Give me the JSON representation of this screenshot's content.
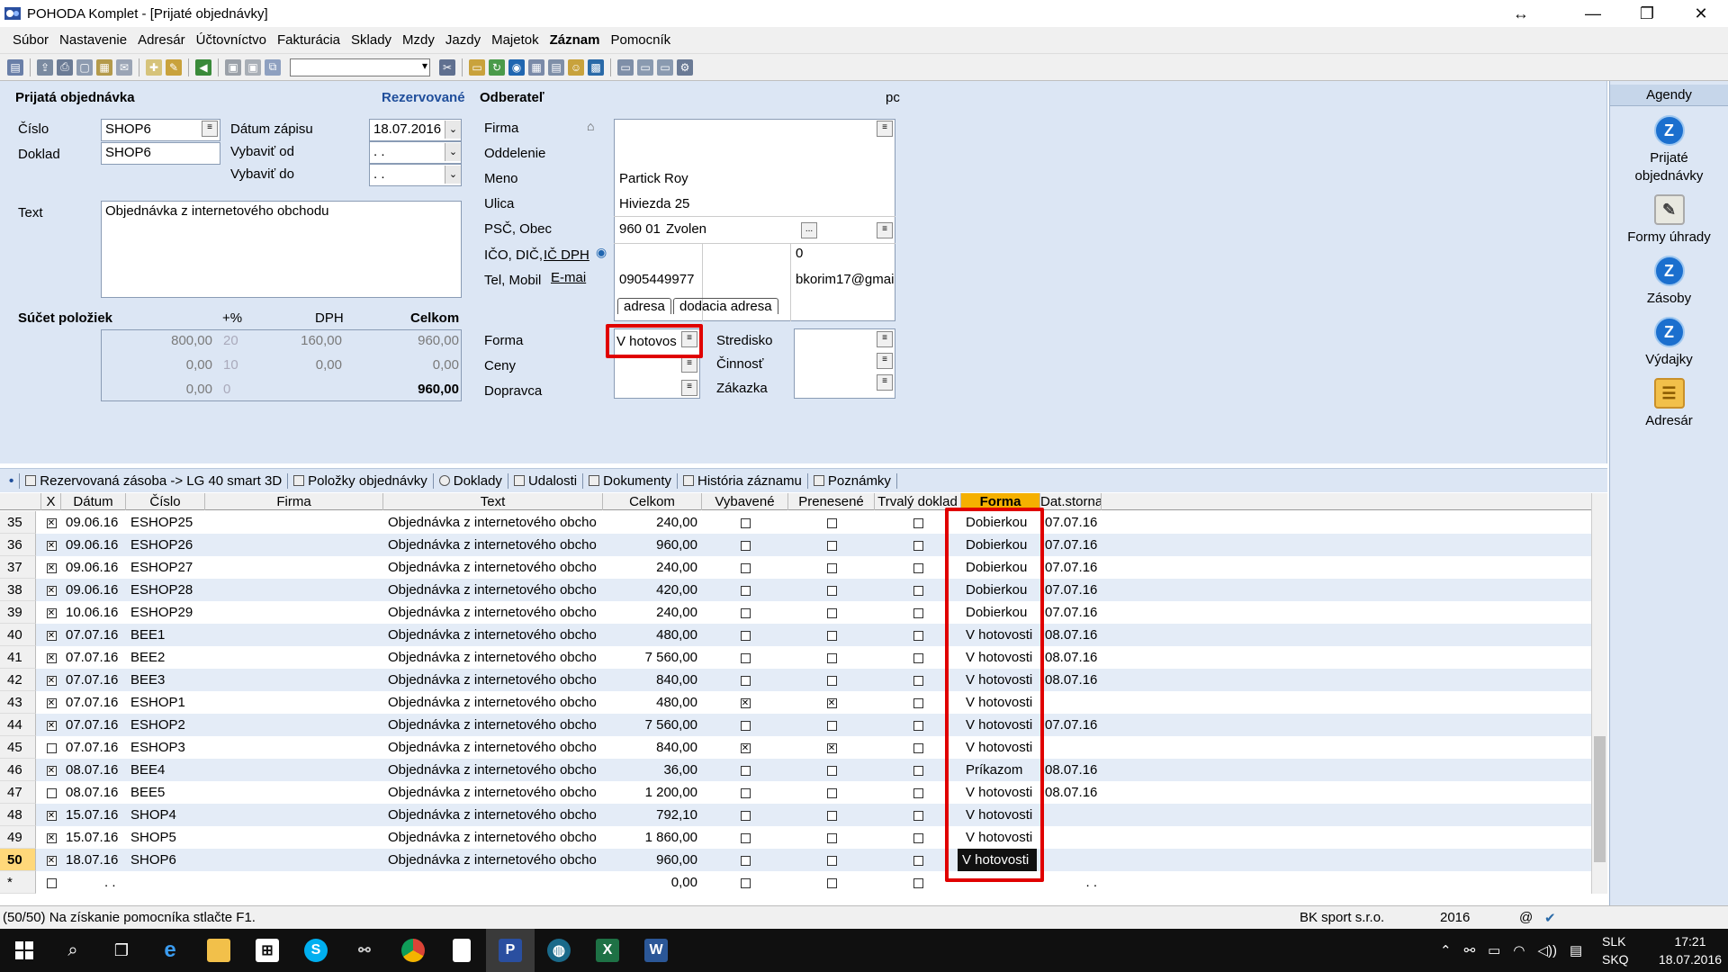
{
  "window": {
    "title": "POHODA Komplet - [Prijaté objednávky]"
  },
  "menu": [
    "Súbor",
    "Nastavenie",
    "Adresár",
    "Účtovníctvo",
    "Fakturácia",
    "Sklady",
    "Mzdy",
    "Jazdy",
    "Majetok",
    "Záznam",
    "Pomocník"
  ],
  "form": {
    "section_title": "Prijatá objednávka",
    "status": "Rezervované",
    "cislo_label": "Číslo",
    "cislo_value": "SHOP6",
    "doklad_label": "Doklad",
    "doklad_value": "SHOP6",
    "datum_zapisu_label": "Dátum zápisu",
    "datum_zapisu_value": "18.07.2016",
    "vybavit_od_label": "Vybaviť od",
    "vybavit_od_value": ". .",
    "vybavit_do_label": "Vybaviť do",
    "vybavit_do_value": ". .",
    "text_label": "Text",
    "text_value": "Objednávka z internetového obchodu",
    "sucet_label": "Súčet položiek",
    "col_pct": "+%",
    "col_dph": "DPH",
    "col_celkom": "Celkom",
    "sum_rows": [
      {
        "base": "800,00",
        "pct": "20",
        "dph": "160,00",
        "total": "960,00"
      },
      {
        "base": "0,00",
        "pct": "10",
        "dph": "0,00",
        "total": "0,00"
      },
      {
        "base": "0,00",
        "pct": "0",
        "dph": "",
        "total": "960,00"
      }
    ],
    "odberatel_label": "Odberateľ",
    "pc": "pc",
    "firma_label": "Firma",
    "oddelenie_label": "Oddelenie",
    "meno_label": "Meno",
    "meno_value": "Partick Roy",
    "ulica_label": "Ulica",
    "ulica_value": "Hiviezda 25",
    "psc_label": "PSČ, Obec",
    "psc_value": "960 01",
    "obec_value": "Zvolen",
    "ico_label": "IČO, DIČ,",
    "ic_dph_label": "IČ DPH",
    "ic_dph_value": "0",
    "tel_label": "Tel, Mobil",
    "email_label": "E-mai",
    "tel_value": "0905449977",
    "email_value": "bkorim17@gmai",
    "addr_tab1": "adresa",
    "addr_tab2": "dodacia adresa",
    "forma_label": "Forma",
    "forma_value": "V hotovos",
    "ceny_label": "Ceny",
    "dopravca_label": "Dopravca",
    "stredisko_label": "Stredisko",
    "cinnost_label": "Činnosť",
    "zakazka_label": "Zákazka"
  },
  "sidebar": {
    "title": "Agendy",
    "items": [
      {
        "label": "Prijaté objednávky",
        "icon": "order-icon"
      },
      {
        "label": "Formy úhrady",
        "icon": "payment-form-icon"
      },
      {
        "label": "Zásoby",
        "icon": "stock-icon"
      },
      {
        "label": "Výdajky",
        "icon": "issue-icon"
      },
      {
        "label": "Adresár",
        "icon": "address-book-icon"
      }
    ]
  },
  "tabs": [
    "Rezervovaná zásoba -> LG 40 smart 3D",
    "Položky objednávky",
    "Doklady",
    "Udalosti",
    "Dokumenty",
    "História záznamu",
    "Poznámky"
  ],
  "grid": {
    "headers": [
      "X",
      "Dátum",
      "Číslo",
      "Firma",
      "Text",
      "Celkom",
      "Vybavené",
      "Prenesené",
      "Trvalý doklad",
      "Forma",
      "Dat.storna"
    ],
    "rows": [
      {
        "n": "35",
        "x": true,
        "date": "09.06.16",
        "num": "ESHOP25",
        "text": "Objednávka z internetového obcho",
        "total": "240,00",
        "vyb": false,
        "pren": false,
        "trv": false,
        "forma": "Dobierkou",
        "storno": "07.07.16"
      },
      {
        "n": "36",
        "x": true,
        "date": "09.06.16",
        "num": "ESHOP26",
        "text": "Objednávka z internetového obcho",
        "total": "960,00",
        "vyb": false,
        "pren": false,
        "trv": false,
        "forma": "Dobierkou",
        "storno": "07.07.16"
      },
      {
        "n": "37",
        "x": true,
        "date": "09.06.16",
        "num": "ESHOP27",
        "text": "Objednávka z internetového obcho",
        "total": "240,00",
        "vyb": false,
        "pren": false,
        "trv": false,
        "forma": "Dobierkou",
        "storno": "07.07.16"
      },
      {
        "n": "38",
        "x": true,
        "date": "09.06.16",
        "num": "ESHOP28",
        "text": "Objednávka z internetového obcho",
        "total": "420,00",
        "vyb": false,
        "pren": false,
        "trv": false,
        "forma": "Dobierkou",
        "storno": "07.07.16"
      },
      {
        "n": "39",
        "x": true,
        "date": "10.06.16",
        "num": "ESHOP29",
        "text": "Objednávka z internetového obcho",
        "total": "240,00",
        "vyb": false,
        "pren": false,
        "trv": false,
        "forma": "Dobierkou",
        "storno": "07.07.16"
      },
      {
        "n": "40",
        "x": true,
        "date": "07.07.16",
        "num": "BEE1",
        "text": "Objednávka z internetového obcho",
        "total": "480,00",
        "vyb": false,
        "pren": false,
        "trv": false,
        "forma": "V hotovosti",
        "storno": "08.07.16"
      },
      {
        "n": "41",
        "x": true,
        "date": "07.07.16",
        "num": "BEE2",
        "text": "Objednávka z internetového obcho",
        "total": "7 560,00",
        "vyb": false,
        "pren": false,
        "trv": false,
        "forma": "V hotovosti",
        "storno": "08.07.16"
      },
      {
        "n": "42",
        "x": true,
        "date": "07.07.16",
        "num": "BEE3",
        "text": "Objednávka z internetového obcho",
        "total": "840,00",
        "vyb": false,
        "pren": false,
        "trv": false,
        "forma": "V hotovosti",
        "storno": "08.07.16"
      },
      {
        "n": "43",
        "x": true,
        "date": "07.07.16",
        "num": "ESHOP1",
        "text": "Objednávka z internetového obcho",
        "total": "480,00",
        "vyb": true,
        "pren": true,
        "trv": false,
        "forma": "V hotovosti",
        "storno": ""
      },
      {
        "n": "44",
        "x": true,
        "date": "07.07.16",
        "num": "ESHOP2",
        "text": "Objednávka z internetového obcho",
        "total": "7 560,00",
        "vyb": false,
        "pren": false,
        "trv": false,
        "forma": "V hotovosti",
        "storno": "07.07.16"
      },
      {
        "n": "45",
        "x": false,
        "date": "07.07.16",
        "num": "ESHOP3",
        "text": "Objednávka z internetového obcho",
        "total": "840,00",
        "vyb": true,
        "pren": true,
        "trv": false,
        "forma": "V hotovosti",
        "storno": ""
      },
      {
        "n": "46",
        "x": true,
        "date": "08.07.16",
        "num": "BEE4",
        "text": "Objednávka z internetového obcho",
        "total": "36,00",
        "vyb": false,
        "pren": false,
        "trv": false,
        "forma": "Príkazom",
        "storno": "08.07.16"
      },
      {
        "n": "47",
        "x": false,
        "date": "08.07.16",
        "num": "BEE5",
        "text": "Objednávka z internetového obcho",
        "total": "1 200,00",
        "vyb": false,
        "pren": false,
        "trv": false,
        "forma": "V hotovosti",
        "storno": "08.07.16"
      },
      {
        "n": "48",
        "x": true,
        "date": "15.07.16",
        "num": "SHOP4",
        "text": "Objednávka z internetového obcho",
        "total": "792,10",
        "vyb": false,
        "pren": false,
        "trv": false,
        "forma": "V hotovosti",
        "storno": ""
      },
      {
        "n": "49",
        "x": true,
        "date": "15.07.16",
        "num": "SHOP5",
        "text": "Objednávka z internetového obcho",
        "total": "1 860,00",
        "vyb": false,
        "pren": false,
        "trv": false,
        "forma": "V hotovosti",
        "storno": ""
      },
      {
        "n": "50",
        "x": true,
        "date": "18.07.16",
        "num": "SHOP6",
        "text": "Objednávka z internetového obcho",
        "total": "960,00",
        "vyb": false,
        "pren": false,
        "trv": false,
        "forma": "V hotovosti",
        "storno": "",
        "selected": true
      }
    ],
    "new_row": {
      "n": "*",
      "date": ". .",
      "total": "0,00",
      "storno": ". ."
    }
  },
  "statusbar": {
    "hint": "(50/50) Na získanie pomocníka stlačte F1.",
    "company": "BK sport s.r.o.",
    "year": "2016",
    "at": "@"
  },
  "taskbar": {
    "lang1": "SLK",
    "lang2": "SKQ",
    "time": "17:21",
    "date": "18.07.2016"
  },
  "colors": {
    "form_bg": "#dce6f4",
    "highlight": "#e00000",
    "selected_row": "#ffd87a"
  }
}
